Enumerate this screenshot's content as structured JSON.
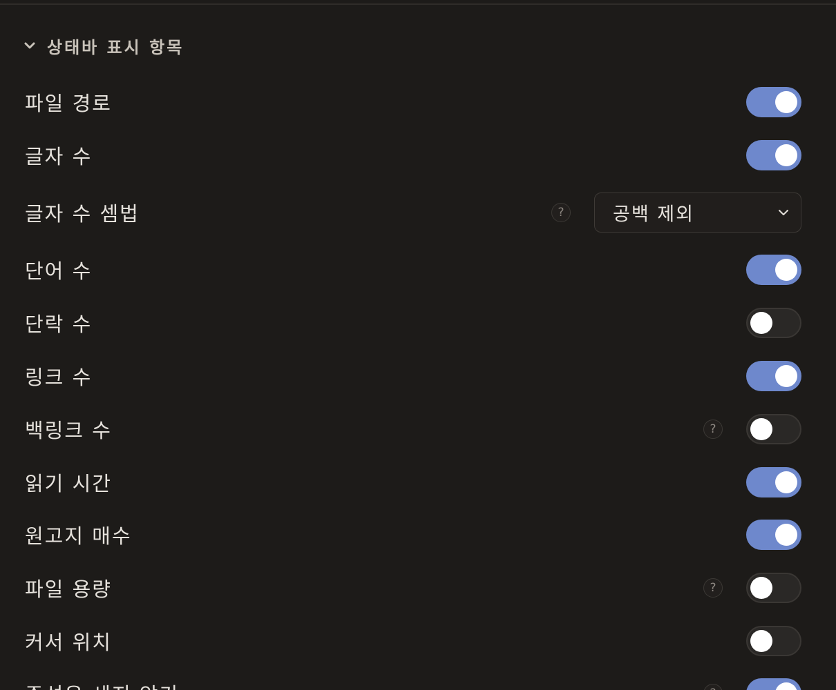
{
  "section": {
    "title": "상태바 표시 항목",
    "icon": "chevron-down-icon"
  },
  "rows": [
    {
      "label": "파일 경로",
      "control": "toggle",
      "on": true
    },
    {
      "label": "글자 수",
      "control": "toggle",
      "on": true
    },
    {
      "label": "글자 수 셈법",
      "control": "select",
      "help": true,
      "value": "공백 제외"
    },
    {
      "label": "단어 수",
      "control": "toggle",
      "on": true
    },
    {
      "label": "단락 수",
      "control": "toggle",
      "on": false
    },
    {
      "label": "링크 수",
      "control": "toggle",
      "on": true
    },
    {
      "label": "백링크 수",
      "control": "toggle",
      "on": false,
      "help": true
    },
    {
      "label": "읽기 시간",
      "control": "toggle",
      "on": true
    },
    {
      "label": "원고지 매수",
      "control": "toggle",
      "on": true
    },
    {
      "label": "파일 용량",
      "control": "toggle",
      "on": false,
      "help": true
    },
    {
      "label": "커서 위치",
      "control": "toggle",
      "on": false
    },
    {
      "label": "주석은 세지 않기",
      "control": "toggle",
      "on": true,
      "help": true
    }
  ],
  "help_glyph": "?",
  "colors": {
    "background": "#1d1b19",
    "toggle_on": "#6e88cc",
    "toggle_off": "#2a2826",
    "text": "#e6e2dc"
  }
}
